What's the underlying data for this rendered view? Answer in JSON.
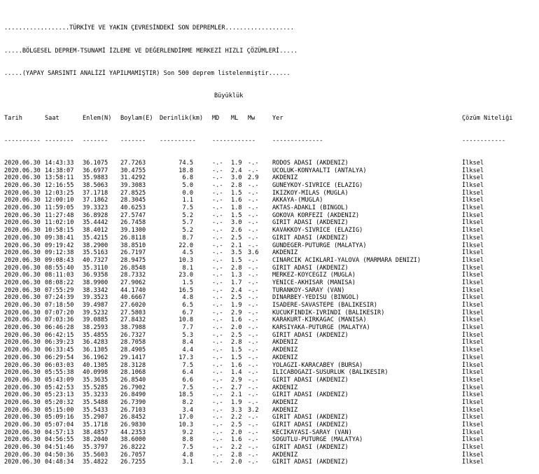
{
  "header": {
    "line1": "..................TÜRKİYE VE YAKIN ÇEVRESİNDEKİ SON DEPREMLER...................",
    "line2": ".....BÖLGESEL DEPREM-TSUNAMİ İZLEME VE DEĞERLENDİRME MERKEZİ HIZLI ÇÖZÜMLERİ.....",
    "line3": ".....(YAPAY SARSINTI ANALİZİ YAPILMAMIŞTIR) Son 500 deprem listelenmiştir......",
    "magnitude_group": "Büyüklük"
  },
  "columns": {
    "date": "Tarih",
    "time": "Saat",
    "lat": "Enlem(N)",
    "lon": "Boylam(E)",
    "depth": "Derinlik(km)",
    "md": "MD",
    "ml": "ML",
    "mw": "Mw",
    "place": "Yer",
    "quality": "Çözüm Niteliği"
  },
  "separators": {
    "date": "----------",
    "time": "--------",
    "lat": "-------",
    "lon": "-------",
    "depth": "----------",
    "mag": "------------",
    "place": "--------------",
    "quality": "------------"
  },
  "rows": [
    [
      "2020.06.30",
      "14:43:33",
      "36.1075",
      "27.7263",
      "74.5",
      "-.-",
      "1.9",
      "-.-",
      "RODOS ADASI (AKDENIZ)",
      "İlksel"
    ],
    [
      "2020.06.30",
      "14:38:07",
      "36.6977",
      "30.4755",
      "18.8",
      "-.-",
      "2.4",
      "-.-",
      "UCOLUK-KONYAALTI (ANTALYA)",
      "İlksel"
    ],
    [
      "2020.06.30",
      "13:58:11",
      "35.9883",
      "31.4292",
      "6.8",
      "-.-",
      "3.0",
      "2.9",
      "AKDENIZ",
      "İlksel"
    ],
    [
      "2020.06.30",
      "12:16:55",
      "38.5063",
      "39.3083",
      "5.0",
      "-.-",
      "2.8",
      "-.-",
      "GUNEYKOY-SIVRICE (ELAZIG)",
      "İlksel"
    ],
    [
      "2020.06.30",
      "12:03:25",
      "37.1718",
      "27.8525",
      "0.0",
      "-.-",
      "1.5",
      "-.-",
      "IKIZKOY-MILAS (MUGLA)",
      "İlksel"
    ],
    [
      "2020.06.30",
      "12:00:10",
      "37.1862",
      "28.3045",
      "1.1",
      "-.-",
      "1.6",
      "-.-",
      "AKKAYA-(MUGLA)",
      "İlksel"
    ],
    [
      "2020.06.30",
      "11:59:05",
      "39.3323",
      "40.6253",
      "7.5",
      "-.-",
      "1.8",
      "-.-",
      "AKTAS-ADAKLI (BINGOL)",
      "İlksel"
    ],
    [
      "2020.06.30",
      "11:27:48",
      "36.8928",
      "27.5747",
      "5.2",
      "-.-",
      "1.5",
      "-.-",
      "GOKOVA KORFEZI (AKDENIZ)",
      "İlksel"
    ],
    [
      "2020.06.30",
      "11:02:10",
      "35.4442",
      "26.7458",
      "5.7",
      "-.-",
      "3.0",
      "-.-",
      "GIRIT ADASI (AKDENIZ)",
      "İlksel"
    ],
    [
      "2020.06.30",
      "10:58:15",
      "38.4012",
      "39.1300",
      "5.2",
      "-.-",
      "2.6",
      "-.-",
      "KAVAKKOY-SIVRICE (ELAZIG)",
      "İlksel"
    ],
    [
      "2020.06.30",
      "09:38:41",
      "35.4215",
      "26.8118",
      "8.7",
      "-.-",
      "2.5",
      "-.-",
      "GIRIT ADASI (AKDENIZ)",
      "İlksel"
    ],
    [
      "2020.06.30",
      "09:19:42",
      "38.2900",
      "38.8510",
      "22.0",
      "-.-",
      "2.1",
      "-.-",
      "GUNDEGER-PUTURGE (MALATYA)",
      "İlksel"
    ],
    [
      "2020.06.30",
      "09:12:38",
      "35.5163",
      "26.7197",
      "4.5",
      "-.-",
      "3.5",
      "3.6",
      "AKDENIZ",
      "İlksel"
    ],
    [
      "2020.06.30",
      "09:08:43",
      "40.7327",
      "28.9475",
      "10.3",
      "-.-",
      "1.5",
      "-.-",
      "CINARCIK ACIKLARI-YALOVA (MARMARA DENIZI)",
      "İlksel"
    ],
    [
      "2020.06.30",
      "08:55:40",
      "35.3110",
      "26.8548",
      "8.1",
      "-.-",
      "2.8",
      "-.-",
      "GIRIT ADASI (AKDENIZ)",
      "İlksel"
    ],
    [
      "2020.06.30",
      "08:11:03",
      "36.9358",
      "28.7332",
      "23.0",
      "-.-",
      "1.3",
      "-.-",
      "MERKEZ-KOYCEGIZ (MUGLA)",
      "İlksel"
    ],
    [
      "2020.06.30",
      "08:08:22",
      "38.9900",
      "27.9062",
      "1.5",
      "-.-",
      "1.7",
      "-.-",
      "YENICE-AKHISAR (MANISA)",
      "İlksel"
    ],
    [
      "2020.06.30",
      "07:55:29",
      "38.3342",
      "44.1740",
      "16.5",
      "-.-",
      "2.4",
      "-.-",
      "TURANKOY-SARAY (VAN)",
      "İlksel"
    ],
    [
      "2020.06.30",
      "07:24:39",
      "39.3523",
      "40.6667",
      "4.8",
      "-.-",
      "2.5",
      "-.-",
      "DINARBEY-YEDISU (BINGOL)",
      "İlksel"
    ],
    [
      "2020.06.30",
      "07:18:50",
      "39.4987",
      "27.6020",
      "6.5",
      "-.-",
      "1.9",
      "-.-",
      "ISADERE-SAVASTEPE (BALIKESIR)",
      "İlksel"
    ],
    [
      "2020.06.30",
      "07:07:20",
      "39.5232",
      "27.5803",
      "6.7",
      "-.-",
      "2.9",
      "-.-",
      "KUCUKFINDIK-IVRINDI (BALIKESIR)",
      "İlksel"
    ],
    [
      "2020.06.30",
      "07:03:36",
      "39.0885",
      "27.8432",
      "10.8",
      "-.-",
      "1.6",
      "-.-",
      "KARAKURT-KIRKAGAC (MANISA)",
      "İlksel"
    ],
    [
      "2020.06.30",
      "06:46:28",
      "38.2593",
      "38.7988",
      "7.7",
      "-.-",
      "2.0",
      "-.-",
      "KARSIYAKA-PUTURGE (MALATYA)",
      "İlksel"
    ],
    [
      "2020.06.30",
      "06:42:15",
      "35.4855",
      "26.7327",
      "5.3",
      "-.-",
      "2.5",
      "-.-",
      "GIRIT ADASI (AKDENIZ)",
      "İlksel"
    ],
    [
      "2020.06.30",
      "06:39:23",
      "36.4283",
      "28.7058",
      "8.4",
      "-.-",
      "2.8",
      "-.-",
      "AKDENIZ",
      "İlksel"
    ],
    [
      "2020.06.30",
      "06:33:45",
      "36.1305",
      "28.4905",
      "4.4",
      "-.-",
      "1.5",
      "-.-",
      "AKDENIZ",
      "İlksel"
    ],
    [
      "2020.06.30",
      "06:29:54",
      "36.1962",
      "29.1417",
      "17.3",
      "-.-",
      "1.5",
      "-.-",
      "AKDENIZ",
      "İlksel"
    ],
    [
      "2020.06.30",
      "06:03:03",
      "40.1305",
      "28.3128",
      "7.5",
      "-.-",
      "1.6",
      "-.-",
      "YOLAGZI-KARACABEY (BURSA)",
      "İlksel"
    ],
    [
      "2020.06.30",
      "05:55:38",
      "40.0998",
      "28.1068",
      "6.4",
      "-.-",
      "1.4",
      "-.-",
      "ILICABOGAZI-SUSURLUK (BALIKESIR)",
      "İlksel"
    ],
    [
      "2020.06.30",
      "05:43:09",
      "35.3635",
      "26.8540",
      "6.6",
      "-.-",
      "2.9",
      "-.-",
      "GIRIT ADASI (AKDENIZ)",
      "İlksel"
    ],
    [
      "2020.06.30",
      "05:42:53",
      "35.5285",
      "26.7902",
      "7.5",
      "-.-",
      "2.7",
      "-.-",
      "AKDENIZ",
      "İlksel"
    ],
    [
      "2020.06.30",
      "05:23:13",
      "35.3233",
      "26.8490",
      "18.5",
      "-.-",
      "2.1",
      "-.-",
      "GIRIT ADASI (AKDENIZ)",
      "İlksel"
    ],
    [
      "2020.06.30",
      "05:20:32",
      "35.5488",
      "26.7390",
      "8.2",
      "-.-",
      "1.9",
      "-.-",
      "AKDENIZ",
      "İlksel"
    ],
    [
      "2020.06.30",
      "05:15:00",
      "35.5433",
      "26.7103",
      "3.4",
      "-.-",
      "3.3",
      "3.2",
      "AKDENIZ",
      "İlksel"
    ],
    [
      "2020.06.30",
      "05:09:16",
      "35.2907",
      "26.8452",
      "17.0",
      "-.-",
      "2.2",
      "-.-",
      "GIRIT ADASI (AKDENIZ)",
      "İlksel"
    ],
    [
      "2020.06.30",
      "05:07:04",
      "35.1718",
      "26.9830",
      "10.3",
      "-.-",
      "2.5",
      "-.-",
      "GIRIT ADASI (AKDENIZ)",
      "İlksel"
    ],
    [
      "2020.06.30",
      "04:57:13",
      "38.4857",
      "44.2353",
      "9.2",
      "-.-",
      "2.0",
      "-.-",
      "KECIKAYASI-SARAY (VAN)",
      "İlksel"
    ],
    [
      "2020.06.30",
      "04:56:55",
      "38.2040",
      "38.6000",
      "8.8",
      "-.-",
      "1.6",
      "-.-",
      "SOGUTLU-PUTURGE (MALATYA)",
      "İlksel"
    ],
    [
      "2020.06.30",
      "04:51:46",
      "35.3797",
      "26.8222",
      "7.5",
      "-.-",
      "2.2",
      "-.-",
      "GIRIT ADASI (AKDENIZ)",
      "İlksel"
    ],
    [
      "2020.06.30",
      "04:50:36",
      "35.5603",
      "26.7057",
      "4.8",
      "-.-",
      "2.8",
      "-.-",
      "AKDENIZ",
      "İlksel"
    ],
    [
      "2020.06.30",
      "04:48:34",
      "35.4822",
      "26.7255",
      "3.1",
      "-.-",
      "2.0",
      "-.-",
      "GIRIT ADASI (AKDENIZ)",
      "İlksel"
    ]
  ]
}
